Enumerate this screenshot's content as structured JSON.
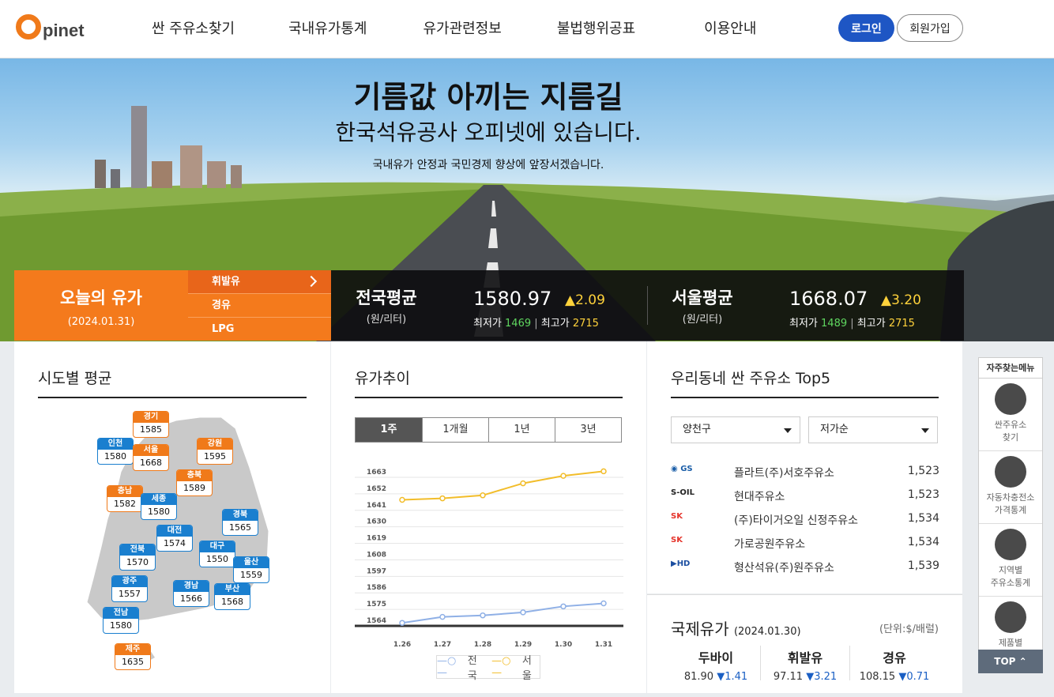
{
  "brand": {
    "logo_letter": "O",
    "logo_rest": "pinet"
  },
  "nav": [
    "싼 주유소찾기",
    "국내유가통계",
    "유가관련정보",
    "불법행위공표",
    "이용안내"
  ],
  "auth": {
    "login": "로그인",
    "join": "회원가입"
  },
  "hero": {
    "title": "기름값 아끼는 지름길",
    "subtitle": "한국석유공사 오피넷에 있습니다.",
    "desc": "국내유가 안정과 국민경제 향상에 앞장서겠습니다."
  },
  "today": {
    "title": "오늘의 유가",
    "date": "(2024.01.31)",
    "tabs": [
      "휘발유",
      "경유",
      "LPG"
    ],
    "active_tab": "휘발유"
  },
  "prices": [
    {
      "label": "전국평균",
      "unit": "(원/리터)",
      "value": "1580.97",
      "change": "▲2.09",
      "min_label": "최저가",
      "min": "1469",
      "max_label": "최고가",
      "max": "2715"
    },
    {
      "label": "서울평균",
      "unit": "(원/리터)",
      "value": "1668.07",
      "change": "▲3.20",
      "min_label": "최저가",
      "min": "1489",
      "max_label": "최고가",
      "max": "2715"
    }
  ],
  "regions": {
    "title": "시도별 평균",
    "items": [
      {
        "name": "경기",
        "value": "1585",
        "color": "orange"
      },
      {
        "name": "인천",
        "value": "1580",
        "color": "blue"
      },
      {
        "name": "서울",
        "value": "1668",
        "color": "orange"
      },
      {
        "name": "강원",
        "value": "1595",
        "color": "orange"
      },
      {
        "name": "충북",
        "value": "1589",
        "color": "orange"
      },
      {
        "name": "충남",
        "value": "1582",
        "color": "orange"
      },
      {
        "name": "세종",
        "value": "1580",
        "color": "blue"
      },
      {
        "name": "경북",
        "value": "1565",
        "color": "blue"
      },
      {
        "name": "대전",
        "value": "1574",
        "color": "blue"
      },
      {
        "name": "전북",
        "value": "1570",
        "color": "blue"
      },
      {
        "name": "대구",
        "value": "1550",
        "color": "blue"
      },
      {
        "name": "울산",
        "value": "1559",
        "color": "blue"
      },
      {
        "name": "광주",
        "value": "1557",
        "color": "blue"
      },
      {
        "name": "경남",
        "value": "1566",
        "color": "blue"
      },
      {
        "name": "부산",
        "value": "1568",
        "color": "blue"
      },
      {
        "name": "전남",
        "value": "1580",
        "color": "blue"
      },
      {
        "name": "제주",
        "value": "1635",
        "color": "orange"
      }
    ]
  },
  "trend": {
    "title": "유가추이",
    "periods": [
      "1주",
      "1개월",
      "1년",
      "3년"
    ],
    "active": "1주",
    "legend": [
      "전국",
      "서울"
    ]
  },
  "chart_data": {
    "type": "line",
    "x": [
      "1.26",
      "1.27",
      "1.28",
      "1.29",
      "1.30",
      "1.31"
    ],
    "y_ticks": [
      "1663",
      "1652",
      "1641",
      "1630",
      "1619",
      "1608",
      "1597",
      "1586",
      "1575",
      "1564"
    ],
    "ylim": [
      1564,
      1663
    ],
    "series": [
      {
        "name": "전국",
        "color": "#8fb0e6",
        "values": [
          1566,
          1570,
          1571,
          1573,
          1577,
          1579
        ]
      },
      {
        "name": "서울",
        "color": "#f2bd2a",
        "values": [
          1648,
          1649,
          1651,
          1659,
          1664,
          1667
        ]
      }
    ]
  },
  "top5": {
    "title": "우리동네 싼 주유소 Top5",
    "district": "양천구",
    "sort": "저가순",
    "items": [
      {
        "brand": "GS칼텍스",
        "name": "플라트(주)서호주유소",
        "price": "1,523"
      },
      {
        "brand": "S-OIL",
        "name": "현대주유소",
        "price": "1,523"
      },
      {
        "brand": "SK에너지",
        "name": "(주)타이거오일 신정주유소",
        "price": "1,534"
      },
      {
        "brand": "SK에너지",
        "name": "가로공원주유소",
        "price": "1,534"
      },
      {
        "brand": "HD HYUNDAI OILBANK",
        "name": "형산석유(주)원주유소",
        "price": "1,539"
      }
    ]
  },
  "intl": {
    "title": "국제유가",
    "date": "(2024.01.30)",
    "unit": "(단위:$/배럴)",
    "items": [
      {
        "name": "두바이",
        "value": "81.90",
        "change": "▼1.41"
      },
      {
        "name": "휘발유",
        "value": "97.11",
        "change": "▼3.21"
      },
      {
        "name": "경유",
        "value": "108.15",
        "change": "▼0.71"
      }
    ]
  },
  "quick": {
    "title": "자주찾는메뉴",
    "items": [
      "싼주유소\n찾기",
      "자동차충전소\n가격통계",
      "지역별\n주유소통계",
      "제품별\n주유소통계"
    ],
    "top": "TOP"
  }
}
